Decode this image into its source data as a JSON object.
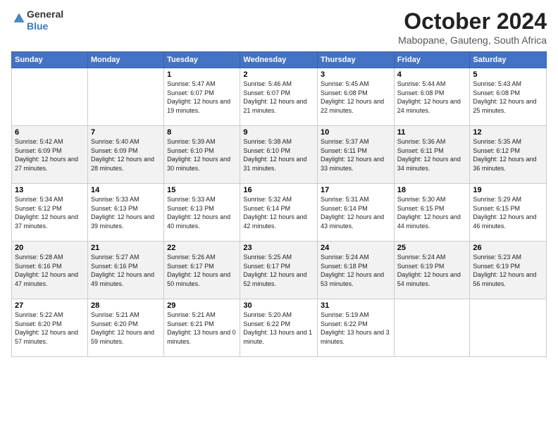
{
  "logo": {
    "general": "General",
    "blue": "Blue"
  },
  "title": {
    "month": "October 2024",
    "location": "Mabopane, Gauteng, South Africa"
  },
  "weekdays": [
    "Sunday",
    "Monday",
    "Tuesday",
    "Wednesday",
    "Thursday",
    "Friday",
    "Saturday"
  ],
  "weeks": [
    [
      {
        "day": "",
        "detail": ""
      },
      {
        "day": "",
        "detail": ""
      },
      {
        "day": "1",
        "detail": "Sunrise: 5:47 AM\nSunset: 6:07 PM\nDaylight: 12 hours and 19 minutes."
      },
      {
        "day": "2",
        "detail": "Sunrise: 5:46 AM\nSunset: 6:07 PM\nDaylight: 12 hours and 21 minutes."
      },
      {
        "day": "3",
        "detail": "Sunrise: 5:45 AM\nSunset: 6:08 PM\nDaylight: 12 hours and 22 minutes."
      },
      {
        "day": "4",
        "detail": "Sunrise: 5:44 AM\nSunset: 6:08 PM\nDaylight: 12 hours and 24 minutes."
      },
      {
        "day": "5",
        "detail": "Sunrise: 5:43 AM\nSunset: 6:08 PM\nDaylight: 12 hours and 25 minutes."
      }
    ],
    [
      {
        "day": "6",
        "detail": "Sunrise: 5:42 AM\nSunset: 6:09 PM\nDaylight: 12 hours and 27 minutes."
      },
      {
        "day": "7",
        "detail": "Sunrise: 5:40 AM\nSunset: 6:09 PM\nDaylight: 12 hours and 28 minutes."
      },
      {
        "day": "8",
        "detail": "Sunrise: 5:39 AM\nSunset: 6:10 PM\nDaylight: 12 hours and 30 minutes."
      },
      {
        "day": "9",
        "detail": "Sunrise: 5:38 AM\nSunset: 6:10 PM\nDaylight: 12 hours and 31 minutes."
      },
      {
        "day": "10",
        "detail": "Sunrise: 5:37 AM\nSunset: 6:11 PM\nDaylight: 12 hours and 33 minutes."
      },
      {
        "day": "11",
        "detail": "Sunrise: 5:36 AM\nSunset: 6:11 PM\nDaylight: 12 hours and 34 minutes."
      },
      {
        "day": "12",
        "detail": "Sunrise: 5:35 AM\nSunset: 6:12 PM\nDaylight: 12 hours and 36 minutes."
      }
    ],
    [
      {
        "day": "13",
        "detail": "Sunrise: 5:34 AM\nSunset: 6:12 PM\nDaylight: 12 hours and 37 minutes."
      },
      {
        "day": "14",
        "detail": "Sunrise: 5:33 AM\nSunset: 6:13 PM\nDaylight: 12 hours and 39 minutes."
      },
      {
        "day": "15",
        "detail": "Sunrise: 5:33 AM\nSunset: 6:13 PM\nDaylight: 12 hours and 40 minutes."
      },
      {
        "day": "16",
        "detail": "Sunrise: 5:32 AM\nSunset: 6:14 PM\nDaylight: 12 hours and 42 minutes."
      },
      {
        "day": "17",
        "detail": "Sunrise: 5:31 AM\nSunset: 6:14 PM\nDaylight: 12 hours and 43 minutes."
      },
      {
        "day": "18",
        "detail": "Sunrise: 5:30 AM\nSunset: 6:15 PM\nDaylight: 12 hours and 44 minutes."
      },
      {
        "day": "19",
        "detail": "Sunrise: 5:29 AM\nSunset: 6:15 PM\nDaylight: 12 hours and 46 minutes."
      }
    ],
    [
      {
        "day": "20",
        "detail": "Sunrise: 5:28 AM\nSunset: 6:16 PM\nDaylight: 12 hours and 47 minutes."
      },
      {
        "day": "21",
        "detail": "Sunrise: 5:27 AM\nSunset: 6:16 PM\nDaylight: 12 hours and 49 minutes."
      },
      {
        "day": "22",
        "detail": "Sunrise: 5:26 AM\nSunset: 6:17 PM\nDaylight: 12 hours and 50 minutes."
      },
      {
        "day": "23",
        "detail": "Sunrise: 5:25 AM\nSunset: 6:17 PM\nDaylight: 12 hours and 52 minutes."
      },
      {
        "day": "24",
        "detail": "Sunrise: 5:24 AM\nSunset: 6:18 PM\nDaylight: 12 hours and 53 minutes."
      },
      {
        "day": "25",
        "detail": "Sunrise: 5:24 AM\nSunset: 6:19 PM\nDaylight: 12 hours and 54 minutes."
      },
      {
        "day": "26",
        "detail": "Sunrise: 5:23 AM\nSunset: 6:19 PM\nDaylight: 12 hours and 56 minutes."
      }
    ],
    [
      {
        "day": "27",
        "detail": "Sunrise: 5:22 AM\nSunset: 6:20 PM\nDaylight: 12 hours and 57 minutes."
      },
      {
        "day": "28",
        "detail": "Sunrise: 5:21 AM\nSunset: 6:20 PM\nDaylight: 12 hours and 59 minutes."
      },
      {
        "day": "29",
        "detail": "Sunrise: 5:21 AM\nSunset: 6:21 PM\nDaylight: 13 hours and 0 minutes."
      },
      {
        "day": "30",
        "detail": "Sunrise: 5:20 AM\nSunset: 6:22 PM\nDaylight: 13 hours and 1 minute."
      },
      {
        "day": "31",
        "detail": "Sunrise: 5:19 AM\nSunset: 6:22 PM\nDaylight: 13 hours and 3 minutes."
      },
      {
        "day": "",
        "detail": ""
      },
      {
        "day": "",
        "detail": ""
      }
    ]
  ]
}
